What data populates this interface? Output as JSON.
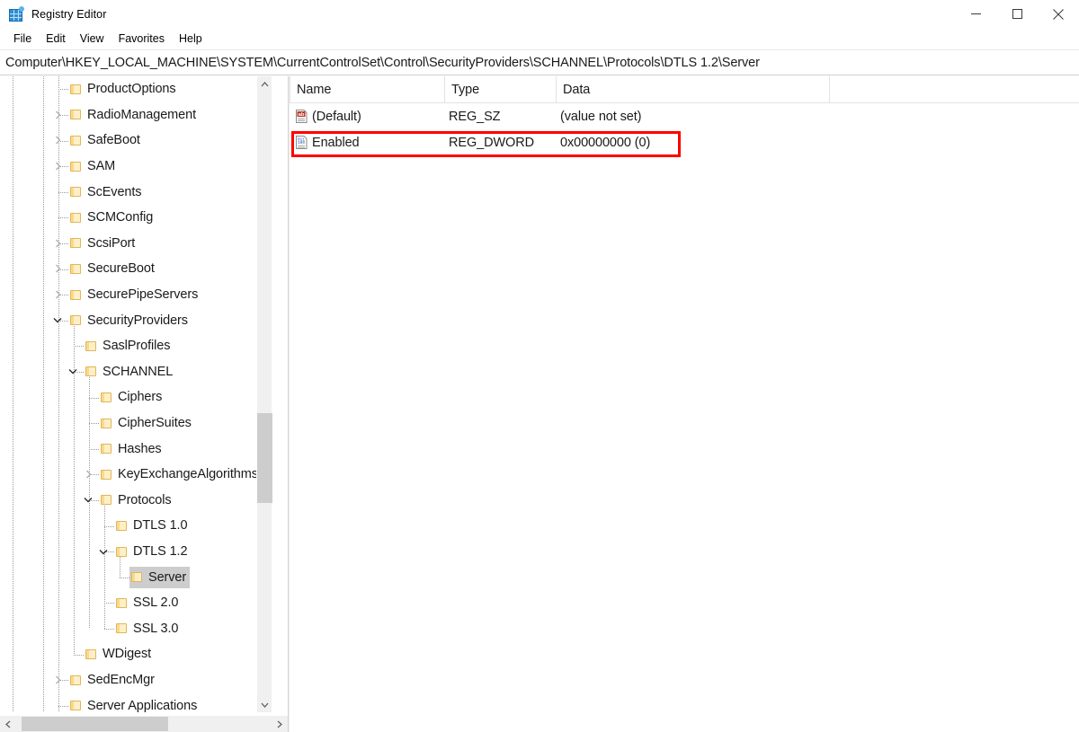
{
  "window": {
    "title": "Registry Editor",
    "icon": "registry-editor-icon",
    "controls": {
      "minimize": "minimize-icon",
      "maximize": "maximize-icon",
      "close": "close-icon"
    }
  },
  "menubar": {
    "items": [
      {
        "label": "File"
      },
      {
        "label": "Edit"
      },
      {
        "label": "View"
      },
      {
        "label": "Favorites"
      },
      {
        "label": "Help"
      }
    ]
  },
  "address": {
    "path": "Computer\\HKEY_LOCAL_MACHINE\\SYSTEM\\CurrentControlSet\\Control\\SecurityProviders\\SCHANNEL\\Protocols\\DTLS 1.2\\Server"
  },
  "tree": {
    "items": [
      {
        "label": "ProductOptions",
        "depth": 3,
        "expander": "none",
        "selected": false
      },
      {
        "label": "RadioManagement",
        "depth": 3,
        "expander": "collapsed",
        "selected": false
      },
      {
        "label": "SafeBoot",
        "depth": 3,
        "expander": "collapsed",
        "selected": false
      },
      {
        "label": "SAM",
        "depth": 3,
        "expander": "collapsed",
        "selected": false
      },
      {
        "label": "ScEvents",
        "depth": 3,
        "expander": "none",
        "selected": false
      },
      {
        "label": "SCMConfig",
        "depth": 3,
        "expander": "none",
        "selected": false
      },
      {
        "label": "ScsiPort",
        "depth": 3,
        "expander": "collapsed",
        "selected": false
      },
      {
        "label": "SecureBoot",
        "depth": 3,
        "expander": "collapsed",
        "selected": false
      },
      {
        "label": "SecurePipeServers",
        "depth": 3,
        "expander": "collapsed",
        "selected": false
      },
      {
        "label": "SecurityProviders",
        "depth": 3,
        "expander": "expanded",
        "selected": false
      },
      {
        "label": "SaslProfiles",
        "depth": 4,
        "expander": "none",
        "selected": false
      },
      {
        "label": "SCHANNEL",
        "depth": 4,
        "expander": "expanded",
        "selected": false
      },
      {
        "label": "Ciphers",
        "depth": 5,
        "expander": "none",
        "selected": false
      },
      {
        "label": "CipherSuites",
        "depth": 5,
        "expander": "none",
        "selected": false
      },
      {
        "label": "Hashes",
        "depth": 5,
        "expander": "none",
        "selected": false
      },
      {
        "label": "KeyExchangeAlgorithms",
        "depth": 5,
        "expander": "collapsed",
        "selected": false
      },
      {
        "label": "Protocols",
        "depth": 5,
        "expander": "expanded",
        "selected": false
      },
      {
        "label": "DTLS 1.0",
        "depth": 6,
        "expander": "none",
        "selected": false
      },
      {
        "label": "DTLS 1.2",
        "depth": 6,
        "expander": "expanded",
        "selected": false
      },
      {
        "label": "Server",
        "depth": 7,
        "expander": "none",
        "selected": true
      },
      {
        "label": "SSL 2.0",
        "depth": 6,
        "expander": "none",
        "selected": false
      },
      {
        "label": "SSL 3.0",
        "depth": 6,
        "expander": "none",
        "selected": false
      },
      {
        "label": "WDigest",
        "depth": 4,
        "expander": "none",
        "selected": false
      },
      {
        "label": "SedEncMgr",
        "depth": 3,
        "expander": "collapsed",
        "selected": false
      },
      {
        "label": "Server Applications",
        "depth": 3,
        "expander": "none",
        "selected": false
      }
    ]
  },
  "values": {
    "columns": [
      {
        "label": "Name"
      },
      {
        "label": "Type"
      },
      {
        "label": "Data"
      }
    ],
    "rows": [
      {
        "name": "(Default)",
        "type": "REG_SZ",
        "data": "(value not set)",
        "icon": "string-value-icon",
        "highlighted": false
      },
      {
        "name": "Enabled",
        "type": "REG_DWORD",
        "data": "0x00000000 (0)",
        "icon": "dword-value-icon",
        "highlighted": true
      }
    ]
  },
  "annotation": {
    "color": "#ff0000",
    "target_row": "Enabled"
  },
  "scrollbars": {
    "tree_vertical": {
      "up": "chevron-up-icon",
      "down": "chevron-down-icon"
    },
    "tree_horizontal": {
      "left": "chevron-left-icon",
      "right": "chevron-right-icon"
    }
  }
}
